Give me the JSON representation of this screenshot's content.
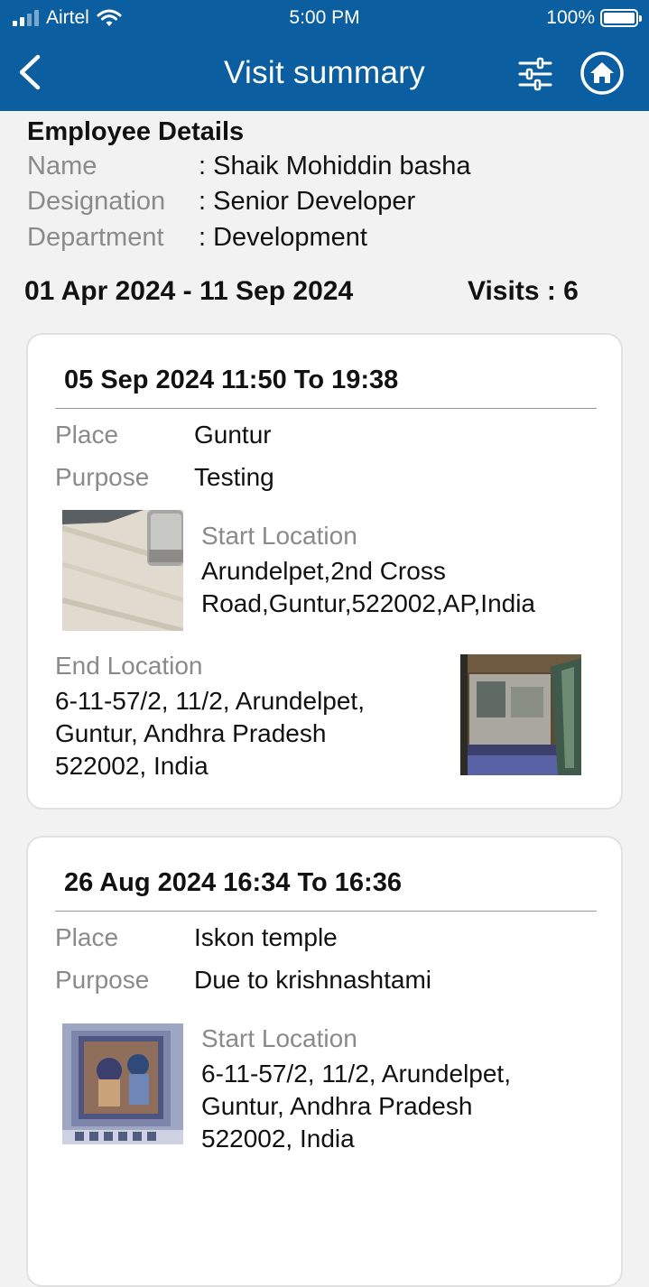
{
  "status_bar": {
    "carrier": "Airtel",
    "time": "5:00 PM",
    "battery": "100%"
  },
  "header": {
    "title": "Visit summary",
    "icons": [
      "back-chevron-icon",
      "filter-sliders-icon",
      "home-icon"
    ]
  },
  "employee": {
    "section_title": "Employee Details",
    "fields": [
      {
        "label": "Name",
        "value": ": Shaik Mohiddin basha"
      },
      {
        "label": "Designation",
        "value": ": Senior Developer"
      },
      {
        "label": "Department",
        "value": ": Development"
      }
    ]
  },
  "summary": {
    "date_range": "01 Apr 2024 - 11 Sep 2024",
    "visits": "Visits :  6"
  },
  "visits": [
    {
      "title": "05 Sep 2024 11:50  To 19:38",
      "place_label": "Place",
      "place": "Guntur",
      "purpose_label": "Purpose",
      "purpose": "Testing",
      "start_label": "Start Location",
      "start_location": "Arundelpet,2nd Cross\nRoad,Guntur,522002,AP,India",
      "end_label": "End Location",
      "end_location": "6-11-57/2, 11/2, Arundelpet,\nGuntur, Andhra Pradesh\n522002, India"
    },
    {
      "title": "26 Aug 2024 16:34  To 16:36",
      "place_label": "Place",
      "place": "Iskon temple",
      "purpose_label": "Purpose",
      "purpose": "Due to krishnashtami",
      "start_label": "Start Location",
      "start_location": "6-11-57/2, 11/2, Arundelpet,\nGuntur, Andhra Pradesh\n522002, India"
    }
  ],
  "colors": {
    "header_bg": "#0b5fa1",
    "page_bg": "#f2f2f2",
    "label_gray": "#8a8a8a"
  }
}
